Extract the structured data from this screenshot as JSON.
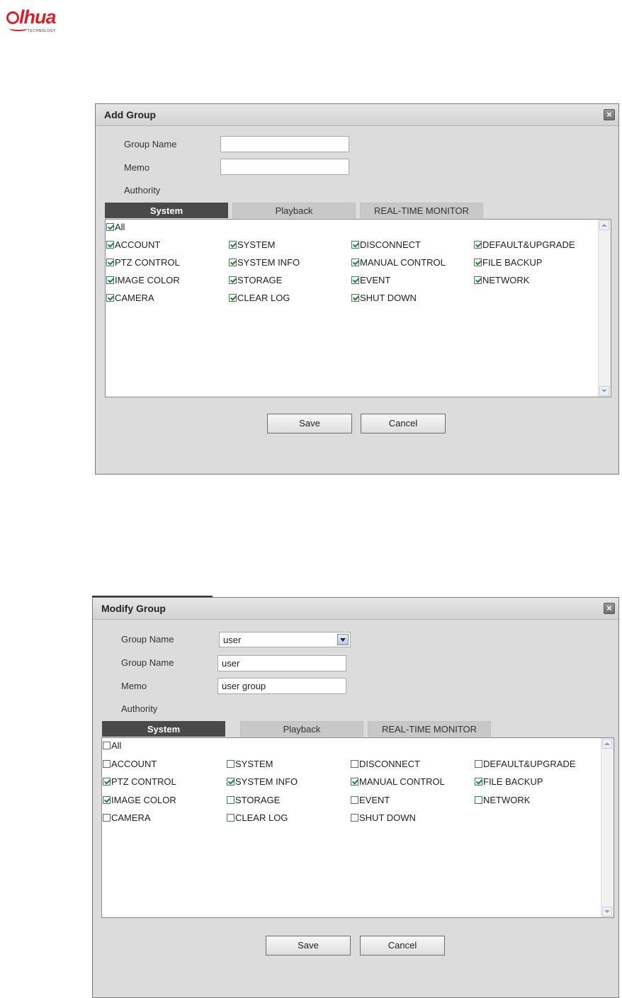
{
  "brand": {
    "name": "alhua",
    "tagline": "TECHNOLOGY"
  },
  "add_dialog": {
    "title": "Add Group",
    "group_name_label": "Group Name",
    "group_name_value": "",
    "memo_label": "Memo",
    "memo_value": "",
    "authority_label": "Authority",
    "tabs": [
      "System",
      "Playback",
      "REAL-TIME MONITOR"
    ],
    "active_tab": "System",
    "all": {
      "label": "All",
      "checked": true
    },
    "checkboxes": [
      {
        "label": "ACCOUNT",
        "checked": true
      },
      {
        "label": "SYSTEM",
        "checked": true
      },
      {
        "label": "DISCONNECT",
        "checked": true
      },
      {
        "label": "DEFAULT&UPGRADE",
        "checked": true
      },
      {
        "label": "PTZ CONTROL",
        "checked": true
      },
      {
        "label": "SYSTEM INFO",
        "checked": true
      },
      {
        "label": "MANUAL CONTROL",
        "checked": true
      },
      {
        "label": "FILE BACKUP",
        "checked": true
      },
      {
        "label": "IMAGE COLOR",
        "checked": true
      },
      {
        "label": "STORAGE",
        "checked": true
      },
      {
        "label": "EVENT",
        "checked": true
      },
      {
        "label": "NETWORK",
        "checked": true
      },
      {
        "label": "CAMERA",
        "checked": true
      },
      {
        "label": "CLEAR LOG",
        "checked": true
      },
      {
        "label": "SHUT DOWN",
        "checked": true
      }
    ],
    "save_label": "Save",
    "cancel_label": "Cancel"
  },
  "modify_dialog": {
    "title": "Modify Group",
    "group_select_label": "Group Name",
    "group_select_value": "user",
    "group_name_label": "Group Name",
    "group_name_value": "user",
    "memo_label": "Memo",
    "memo_value": "user group",
    "authority_label": "Authority",
    "tabs": [
      "System",
      "Playback",
      "REAL-TIME MONITOR"
    ],
    "active_tab": "System",
    "all": {
      "label": "All",
      "checked": false
    },
    "checkboxes": [
      {
        "label": "ACCOUNT",
        "checked": false
      },
      {
        "label": "SYSTEM",
        "checked": false
      },
      {
        "label": "DISCONNECT",
        "checked": false
      },
      {
        "label": "DEFAULT&UPGRADE",
        "checked": false
      },
      {
        "label": "PTZ CONTROL",
        "checked": true
      },
      {
        "label": "SYSTEM INFO",
        "checked": true
      },
      {
        "label": "MANUAL CONTROL",
        "checked": true
      },
      {
        "label": "FILE BACKUP",
        "checked": true
      },
      {
        "label": "IMAGE COLOR",
        "checked": true
      },
      {
        "label": "STORAGE",
        "checked": false
      },
      {
        "label": "EVENT",
        "checked": false
      },
      {
        "label": "NETWORK",
        "checked": false
      },
      {
        "label": "CAMERA",
        "checked": false
      },
      {
        "label": "CLEAR LOG",
        "checked": false
      },
      {
        "label": "SHUT DOWN",
        "checked": false
      }
    ],
    "save_label": "Save",
    "cancel_label": "Cancel"
  },
  "colors": {
    "brand_red": "#d8222a",
    "active_tab": "#4a4a4a",
    "dialog_bg": "#dcdcdc",
    "check_green": "#1a8a1a"
  }
}
